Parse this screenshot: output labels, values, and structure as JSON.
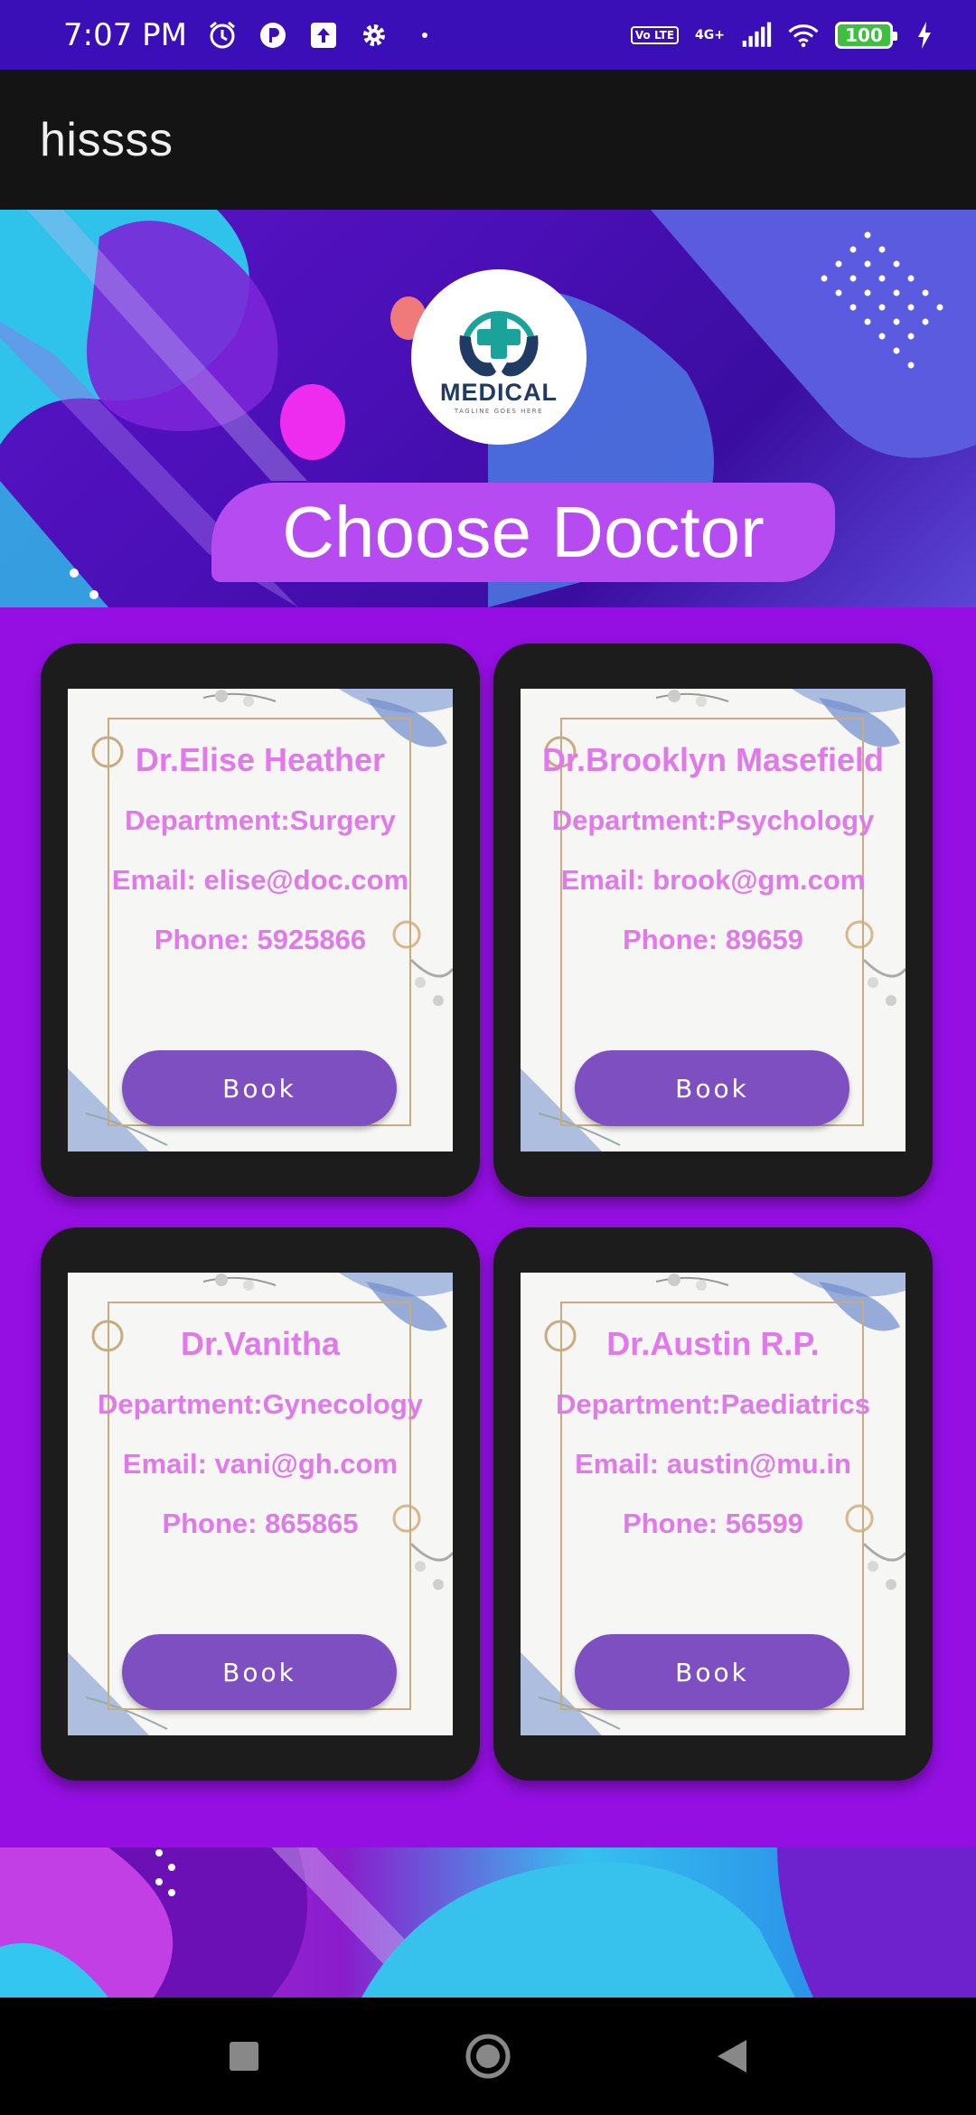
{
  "status_bar": {
    "time": "7:07 PM",
    "lte_label": "Vo LTE",
    "network_label": "4G+",
    "battery_level": "100"
  },
  "app_bar": {
    "title": "hissss"
  },
  "banner": {
    "logo_word": "MEDICAL",
    "logo_tagline": "TAGLINE GOES HERE",
    "heading": "Choose Doctor"
  },
  "doctors": [
    {
      "name": "Dr.Elise Heather",
      "department": "Department:Surgery",
      "email": "Email: elise@doc.com",
      "phone": "Phone: 5925866",
      "button": "Book"
    },
    {
      "name": "Dr.Brooklyn Masefield",
      "department": "Department:Psychology",
      "email": "Email: brook@gm.com",
      "phone": "Phone: 89659",
      "button": "Book"
    },
    {
      "name": "Dr.Vanitha",
      "department": "Department:Gynecology",
      "email": "Email: vani@gh.com",
      "phone": "Phone: 865865",
      "button": "Book"
    },
    {
      "name": "Dr.Austin R.P.",
      "department": "Department:Paediatrics",
      "email": "Email: austin@mu.in",
      "phone": "Phone: 56599",
      "button": "Book"
    }
  ],
  "colors": {
    "status_bar": "#3a0fb8",
    "app_bar": "#141414",
    "main_bg": "#950fe3",
    "card_text": "#e07ae8",
    "book_button": "#7e4fc1"
  },
  "nav_bar": {
    "icons": [
      "recents-square-icon",
      "home-circle-icon",
      "back-triangle-icon"
    ]
  }
}
